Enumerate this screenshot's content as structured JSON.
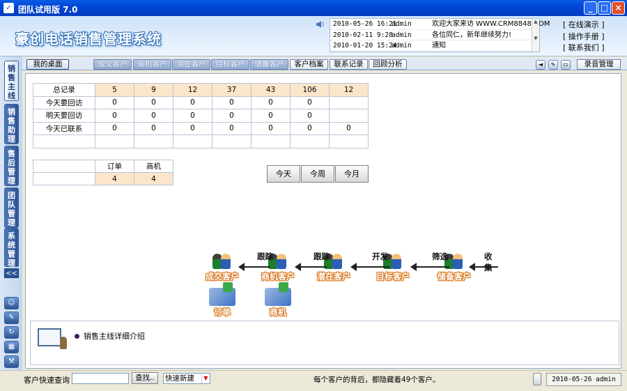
{
  "window": {
    "title": "团队试用版  7.0"
  },
  "header": {
    "logo": "豪创电话销售管理系统",
    "news": [
      {
        "date": "2010-05-26 16:21",
        "user": "admin",
        "text": "欢迎大家来访 WWW.CRM8848.COM"
      },
      {
        "date": "2010-02-11 9:28",
        "user": "admin",
        "text": "各位同仁，新年继续努力!"
      },
      {
        "date": "2010-01-20 15:24",
        "user": "admin",
        "text": "通知"
      }
    ],
    "links": [
      "[  在线演示  ]",
      "[  操作手册  ]",
      "[  联系我们  ]"
    ]
  },
  "leftbar": {
    "tabs": [
      "销售主线",
      "销售助理",
      "售后管理",
      "团队管理",
      "系统管理"
    ],
    "collapse": "<<"
  },
  "nav": {
    "home": "我的桌面",
    "tabs": [
      "成交客户",
      "商机客户",
      "潜在客户",
      "目标客户",
      "储备客户",
      "客户档案",
      "联系记录",
      "回顾分析"
    ],
    "record": "录音管理"
  },
  "stats": {
    "rows": [
      {
        "label": "总记录",
        "values": [
          "5",
          "9",
          "12",
          "37",
          "43",
          "106",
          "12"
        ]
      },
      {
        "label": "今天要回访",
        "values": [
          "0",
          "0",
          "0",
          "0",
          "0",
          "0",
          ""
        ]
      },
      {
        "label": "明天要回访",
        "values": [
          "0",
          "0",
          "0",
          "0",
          "0",
          "0",
          ""
        ]
      },
      {
        "label": "今天已联系",
        "values": [
          "0",
          "0",
          "0",
          "0",
          "0",
          "0",
          "0"
        ]
      },
      {
        "label": "",
        "values": [
          "",
          "",
          "",
          "",
          "",
          "",
          ""
        ]
      }
    ]
  },
  "orders": {
    "headers": [
      "订单",
      "商机"
    ],
    "values": [
      "4",
      "4"
    ]
  },
  "periods": [
    "今天",
    "今周",
    "今月"
  ],
  "flow": {
    "nodes": [
      "成交客户",
      "商机客户",
      "潜在客户",
      "目标客户",
      "储备客户"
    ],
    "arrows": [
      "跟踪",
      "跟踪",
      "开发",
      "筛选",
      "收集"
    ],
    "docs": [
      "订单",
      "商机"
    ]
  },
  "intro": {
    "text": "销售主线详细介绍"
  },
  "statusbar": {
    "query_label": "客户快速查询",
    "query_value": "",
    "search_button": "查找..",
    "new_select": "快速新建",
    "message": "每个客户的背后，都隐藏着49个客户。",
    "date": "2010-05-26 admin"
  }
}
